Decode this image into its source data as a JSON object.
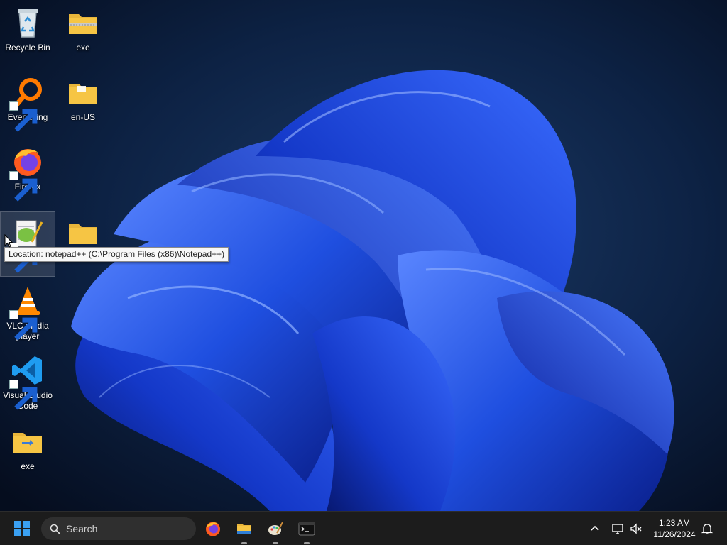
{
  "desktop": {
    "icons": [
      {
        "label": "Recycle Bin",
        "icon": "recycle-bin-icon"
      },
      {
        "label": "exe",
        "icon": "zip-folder-icon"
      },
      {
        "label": "Everything",
        "icon": "everything-search-icon"
      },
      {
        "label": "en-US",
        "icon": "folder-icon"
      },
      {
        "label": "Firefox",
        "icon": "firefox-icon"
      },
      {
        "label": "",
        "icon": "notepad-plus-plus-icon"
      },
      {
        "label": "",
        "icon": "folder-icon"
      },
      {
        "label": "VLC media player",
        "icon": "vlc-icon"
      },
      {
        "label": "Visual Studio Code",
        "icon": "vscode-icon"
      },
      {
        "label": "exe",
        "icon": "folder-icon"
      }
    ],
    "tooltip": "Location: notepad++ (C:\\Program Files (x86)\\Notepad++)"
  },
  "taskbar": {
    "search_placeholder": "Search",
    "apps": [
      "firefox-icon",
      "file-explorer-icon",
      "paint-icon",
      "terminal-icon"
    ],
    "tray_icons": [
      "chevron-up-icon",
      "network-icon",
      "volume-muted-icon",
      "notification-bell-icon"
    ],
    "time": "1:23 AM",
    "date": "11/26/2024"
  },
  "colors": {
    "wallpaper_bg": "#0a1a33",
    "bloom_blue": "#1f4fe0",
    "taskbar_bg": "#1c1c1c",
    "folder_yellow": "#f6c544"
  }
}
